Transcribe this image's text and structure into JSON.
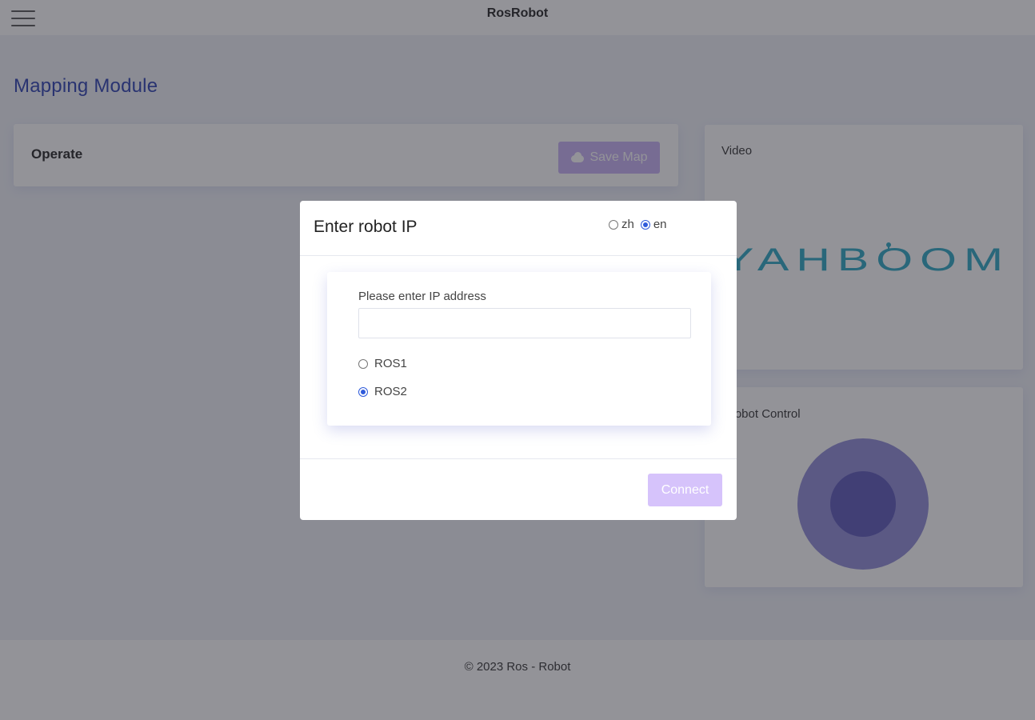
{
  "header": {
    "title": "RosRobot"
  },
  "main": {
    "heading": "Mapping Module",
    "operate": {
      "label": "Operate",
      "save_map_label": "Save Map"
    },
    "video": {
      "label": "Video",
      "logo_text": "YAHBOOM"
    },
    "robot_control": {
      "label": "Robot Control"
    }
  },
  "footer": {
    "text": "© 2023 Ros - Robot"
  },
  "modal": {
    "title": "Enter robot IP",
    "languages": [
      {
        "label": "zh",
        "selected": false
      },
      {
        "label": "en",
        "selected": true
      }
    ],
    "ip_label": "Please enter IP address",
    "ip_value": "",
    "ros_options": [
      {
        "label": "ROS1",
        "selected": false
      },
      {
        "label": "ROS2",
        "selected": true
      }
    ],
    "connect_label": "Connect"
  },
  "colors": {
    "accent": "#2f5bdb",
    "heading": "#2a3fb0",
    "button": "#c7b0f5",
    "joystick_outer": "#8e8bd6",
    "joystick_inner": "#5b57b9",
    "logo": "#2aa7c2"
  }
}
